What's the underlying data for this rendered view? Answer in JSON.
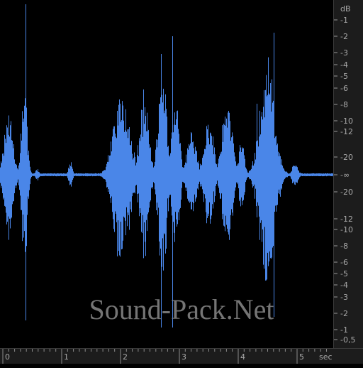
{
  "editor": {
    "wave_color": "#4a86e8",
    "center_line_color": "#4a86e8",
    "background_color": "#000000",
    "ruler_color": "#1c1c1c",
    "ruler_text_color": "#a8a8a8"
  },
  "db_ruler": {
    "unit_label": "dB",
    "upper_labels": [
      "-1",
      "-2",
      "-3",
      "-4",
      "-5",
      "-6",
      "-8",
      "-10",
      "-12",
      "-20"
    ],
    "center_label": "-∞",
    "lower_labels": [
      "-20",
      "-12",
      "-10",
      "-8",
      "-6",
      "-5",
      "-4",
      "-3",
      "-2",
      "-1",
      "-0,5"
    ]
  },
  "time_ruler": {
    "unit_label": "sec",
    "tick_labels": [
      "0",
      "1",
      "2",
      "3",
      "4",
      "5"
    ]
  },
  "watermark": {
    "text": "Sound-Pack.Net"
  }
}
